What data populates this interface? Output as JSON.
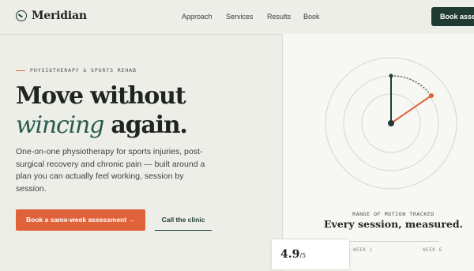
{
  "brand": {
    "name": "Meridian",
    "icon": "compass-dial-icon",
    "color": "#1f3b34"
  },
  "nav": {
    "items": [
      "Approach",
      "Services",
      "Results",
      "Book"
    ]
  },
  "header_cta": {
    "label": "Book assess"
  },
  "hero": {
    "eyebrow": "PHYSIOTHERAPY & SPORTS REHAB",
    "headline_line1": "Move without",
    "headline_accent": "wincing",
    "headline_rest": " again.",
    "intro": "One-on-one physiotherapy for sports injuries, post-surgical recovery and chronic pain — built around a plan you can actually feel working, session by session.",
    "primary_button": "Book a same-week assessment →",
    "secondary_button": "Call the clinic"
  },
  "panel": {
    "kicker": "RANGE OF MOTION TRACKED",
    "title": "Every session, measured.",
    "weeks": [
      "WEEK 1",
      "WEEK 6"
    ]
  },
  "rating": {
    "value": "4.9",
    "max": "/5"
  },
  "colors": {
    "accent": "#e0623a",
    "brand_dark": "#1f3b34",
    "accent_italic": "#2a5b50",
    "background": "#eceee7"
  }
}
